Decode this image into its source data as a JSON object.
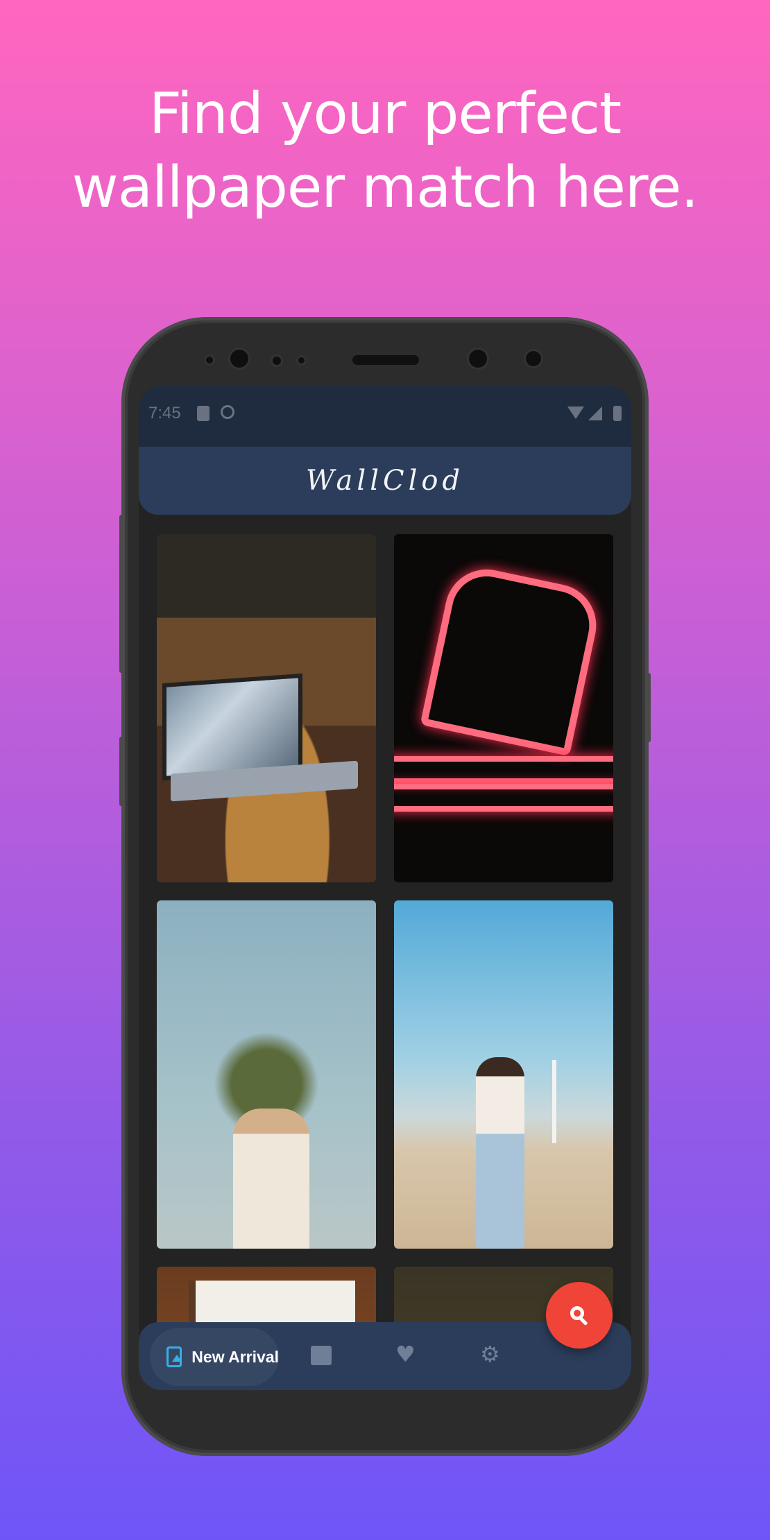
{
  "headline": {
    "line1": "Find your perfect",
    "line2": "wallpaper match here."
  },
  "status_bar": {
    "time": "7:45"
  },
  "app_bar": {
    "title": "WallClod"
  },
  "wallpapers": [
    {
      "subject": "laptop on wooden table"
    },
    {
      "subject": "red neon letter sign"
    },
    {
      "subject": "couple under desert tree"
    },
    {
      "subject": "woman on beach with wind turbines"
    },
    {
      "subject": "interior with window"
    },
    {
      "subject": "dark textured wall"
    }
  ],
  "bottom_nav": {
    "items": [
      {
        "label": "New Arrival",
        "icon": "wallpaper-icon",
        "active": true
      },
      {
        "label": "",
        "icon": "gallery-icon",
        "active": false
      },
      {
        "label": "",
        "icon": "heart-icon",
        "active": false
      },
      {
        "label": "",
        "icon": "gear-icon",
        "active": false
      }
    ]
  },
  "fab": {
    "icon": "search-icon"
  },
  "colors": {
    "gradient_top": "#ff66bf",
    "gradient_bottom": "#6f55f8",
    "app_bar": "#2c3d5b",
    "accent": "#3aaee6",
    "fab": "#ef4437"
  }
}
